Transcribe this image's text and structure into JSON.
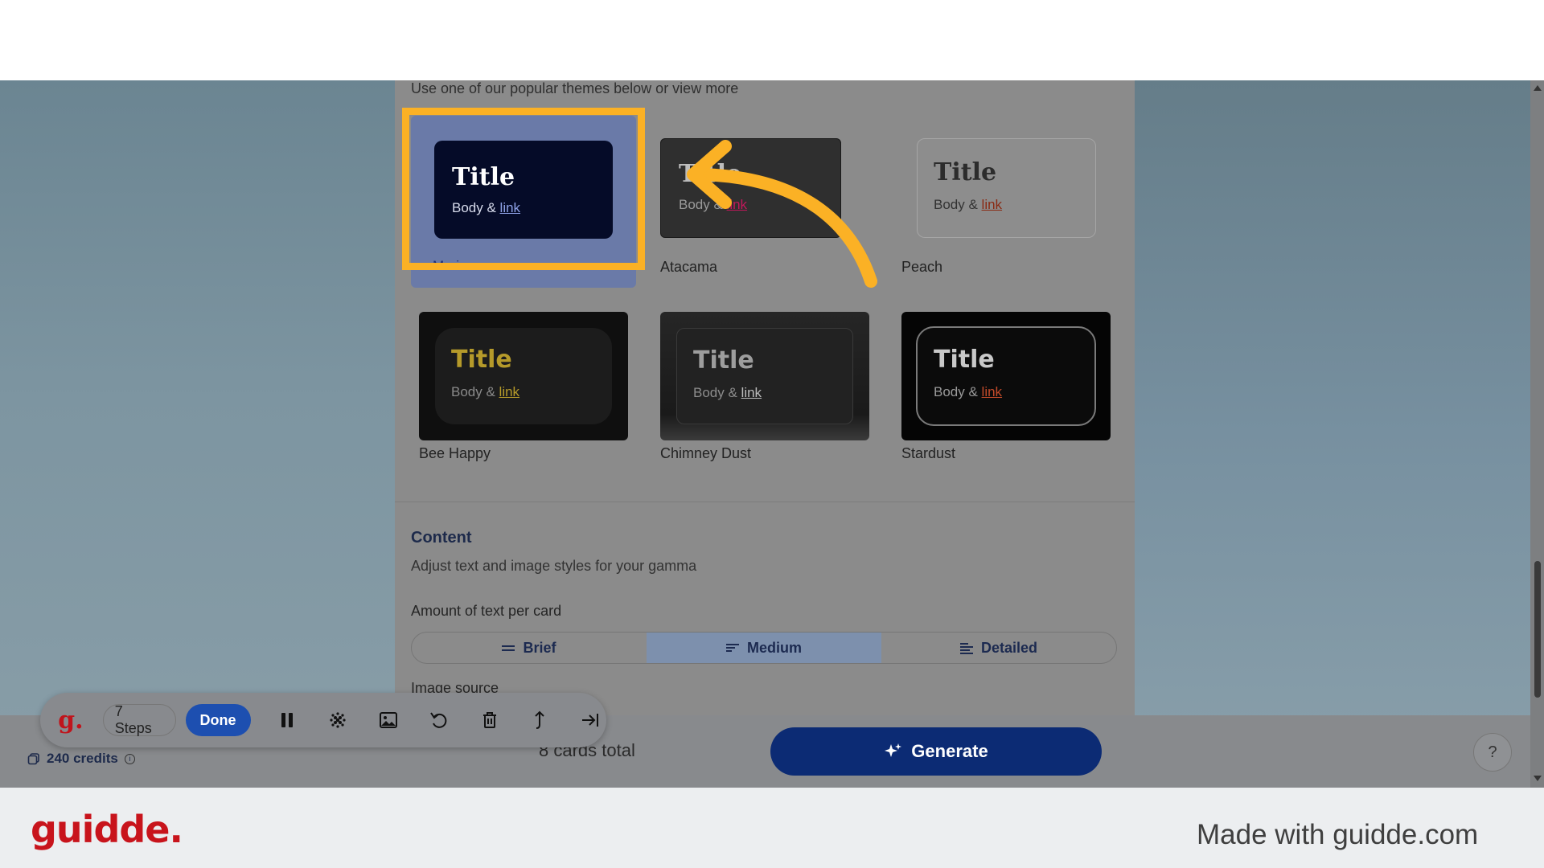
{
  "themes_hint": "Use one of our popular themes below or view more",
  "sample": {
    "title": "Title",
    "body": "Body &",
    "link": "link"
  },
  "themes": [
    {
      "name": "Marine"
    },
    {
      "name": "Atacama"
    },
    {
      "name": "Peach"
    },
    {
      "name": "Bee Happy"
    },
    {
      "name": "Chimney Dust"
    },
    {
      "name": "Stardust"
    }
  ],
  "content": {
    "title": "Content",
    "subtitle": "Adjust text and image styles for your gamma",
    "amount_label": "Amount of text per card",
    "options": [
      {
        "label": "Brief",
        "icon": "lines-icon"
      },
      {
        "label": "Medium",
        "icon": "align-left-icon",
        "selected": true
      },
      {
        "label": "Detailed",
        "icon": "align-left-detailed-icon"
      }
    ],
    "image_source_label": "Image source"
  },
  "footer": {
    "credits": "240 credits",
    "cards_total": "8 cards total",
    "generate_label": "Generate"
  },
  "recorder": {
    "logo": "g.",
    "steps": "7 Steps",
    "done": "Done"
  },
  "help_label": "?",
  "brand": {
    "logo": "guidde.",
    "made_with": "Made with guidde.com",
    "accent": "#c8141c",
    "highlight": "#fbb125"
  }
}
